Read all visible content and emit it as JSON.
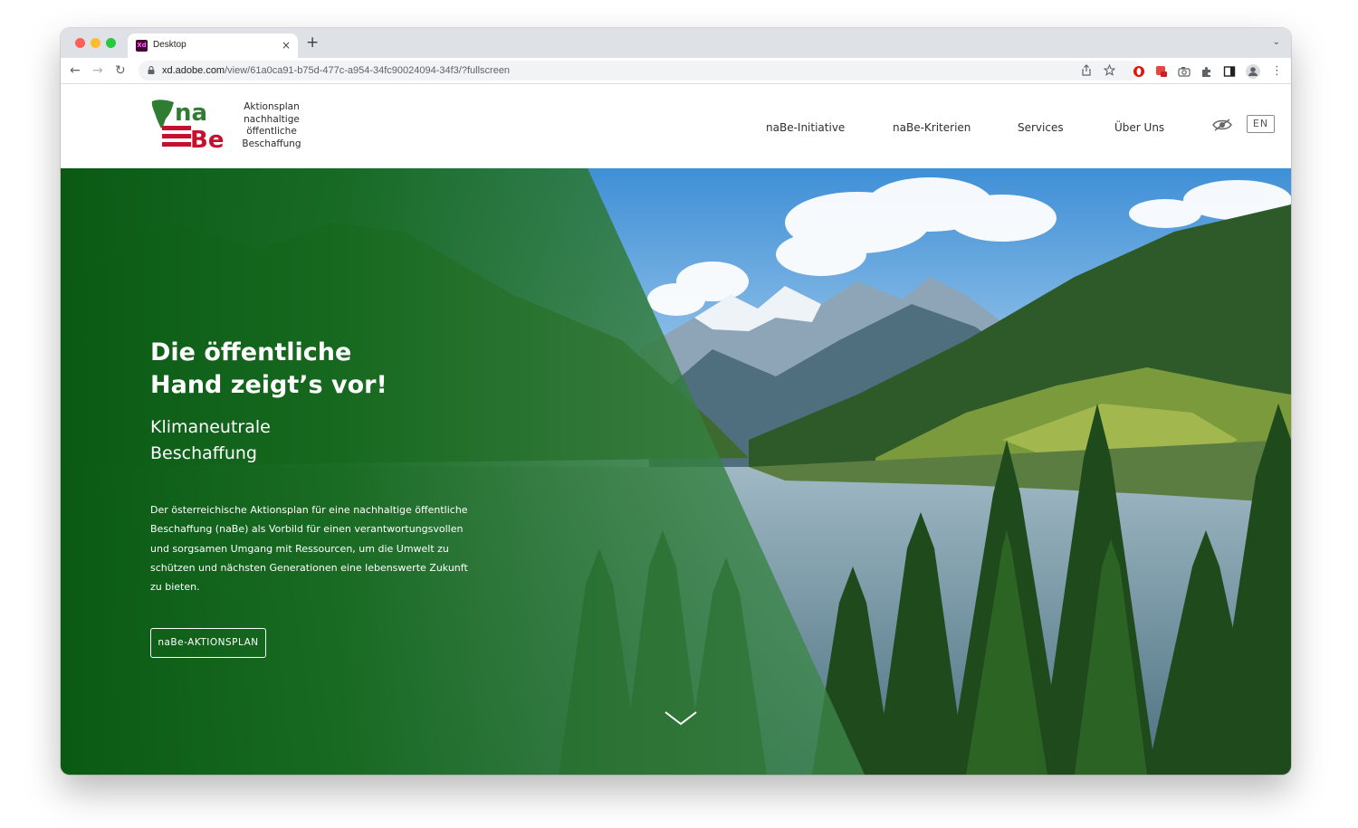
{
  "browser": {
    "tab_title": "Desktop",
    "tab_favicon_text": "Xd",
    "tab_close": "×",
    "new_tab": "+",
    "tab_menu": "⌄",
    "back": "←",
    "forward": "→",
    "reload": "↻",
    "url_host": "xd.adobe.com",
    "url_path": "/view/61a0ca91-b75d-477c-a954-34fc90024094-34f3/?fullscreen",
    "menu": "⋮"
  },
  "site": {
    "logo_na": "na",
    "logo_be": "Be",
    "logo_tagline": [
      "Aktionsplan",
      "nachhaltige",
      "öffentliche",
      "Beschaffung"
    ],
    "nav": [
      "naBe-Initiative",
      "naBe-Kriterien",
      "Services",
      "Über Uns"
    ],
    "language_button": "EN",
    "accent_green": "#1e6b2a",
    "accent_red": "#c8102e"
  },
  "hero": {
    "title_line1": "Die öffentliche",
    "title_line2": "Hand zeigt’s vor!",
    "subtitle_line1": "Klimaneutrale",
    "subtitle_line2": "Beschaffung",
    "body": "Der österreichische Aktionsplan für eine nachhaltige öffentliche Beschaffung (naBe) als Vorbild für einen verantwortungsvollen und sorgsamen Umgang mit Ressourcen, um die Umwelt zu schützen und nächsten Generationen eine lebenswerte Zukunft zu bieten.",
    "cta_label": "naBe-AKTIONSPLAN"
  }
}
